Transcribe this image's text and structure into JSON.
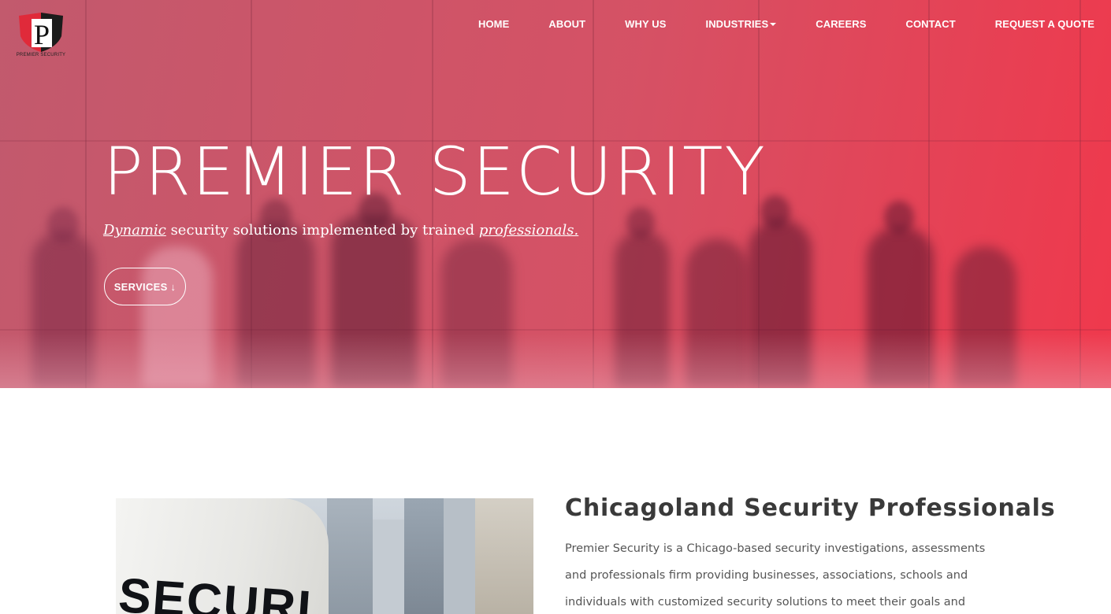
{
  "brand": {
    "logo_letter": "P",
    "logo_text": "PREMIER SECURITY",
    "accent": "#e8394f"
  },
  "nav": {
    "items": [
      {
        "label": "HOME"
      },
      {
        "label": "ABOUT"
      },
      {
        "label": "WHY US"
      },
      {
        "label": "INDUSTRIES",
        "dropdown": true
      },
      {
        "label": "CAREERS"
      },
      {
        "label": "CONTACT"
      },
      {
        "label": "REQUEST A QUOTE"
      }
    ]
  },
  "hero": {
    "title": "PREMIER SECURITY",
    "subtitle_word1": "Dynamic",
    "subtitle_middle": " security solutions implemented by trained ",
    "subtitle_word2": "professionals.",
    "button_label": "SERVICES ↓"
  },
  "intro": {
    "photo_text": "SECURI",
    "heading": "Chicagoland Security Professionals",
    "body": "Premier Security is a Chicago-based security investigations, assessments and professionals firm providing businesses, associations, schools and individuals with customized security solutions to meet their goals and protect their"
  }
}
